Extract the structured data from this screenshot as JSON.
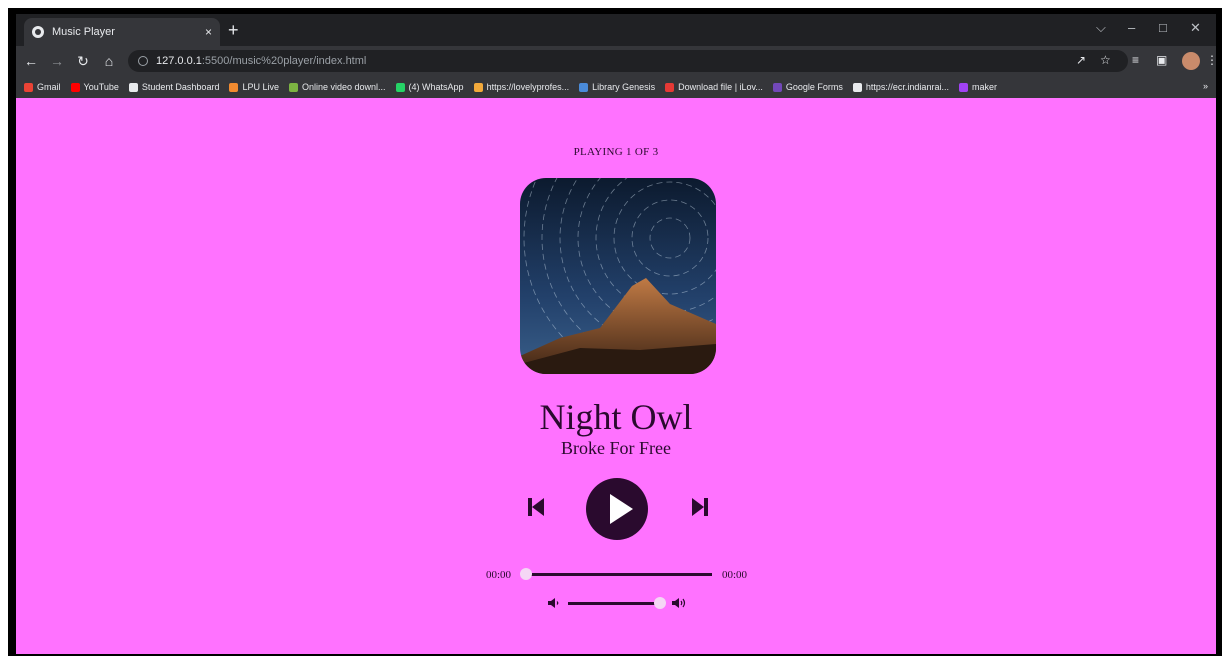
{
  "browser": {
    "tab_title": "Music Player",
    "tab_close": "×",
    "new_tab": "+",
    "url_host": "127.0.0.1",
    "url_path": ":5500/music%20player/index.html",
    "bookmarks": [
      {
        "label": "Gmail",
        "color": "#ea4335"
      },
      {
        "label": "YouTube",
        "color": "#ff0000"
      },
      {
        "label": "Student Dashboard",
        "color": "#e8eaed"
      },
      {
        "label": "LPU Live",
        "color": "#f28b30"
      },
      {
        "label": "Online video downl...",
        "color": "#7cb342"
      },
      {
        "label": "(4) WhatsApp",
        "color": "#25d366"
      },
      {
        "label": "https://lovelyprofes...",
        "color": "#f2a93b"
      },
      {
        "label": "Library Genesis",
        "color": "#4a8bd9"
      },
      {
        "label": "Download file | iLov...",
        "color": "#e53935"
      },
      {
        "label": "Google Forms",
        "color": "#7248b9"
      },
      {
        "label": "https://ecr.indianrai...",
        "color": "#e8eaed"
      },
      {
        "label": "maker",
        "color": "#a142f4"
      }
    ],
    "bookmarks_more": "»"
  },
  "player": {
    "playing_label": "PLAYING 1 OF 3",
    "track_name": "Night Owl",
    "artist": "Broke For Free",
    "current_time": "00:00",
    "duration": "00:00",
    "seek_fraction": 0,
    "volume_fraction": 1,
    "accent_color": "#ff72ff",
    "control_color": "#2a0a2e",
    "icons": {
      "prev": "skip-back-icon",
      "play": "play-icon",
      "next": "skip-forward-icon",
      "vol_low": "volume-low-icon",
      "vol_high": "volume-high-icon"
    }
  }
}
